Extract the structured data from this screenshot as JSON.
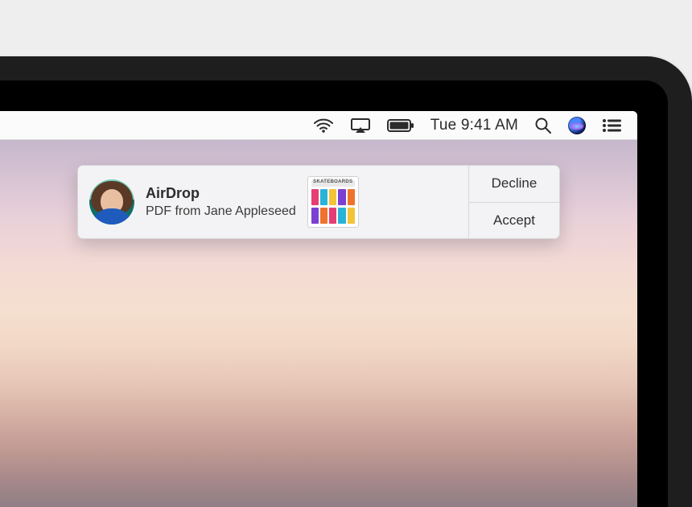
{
  "menubar": {
    "clock": "Tue 9:41 AM",
    "icons": {
      "wifi": "wifi-icon",
      "airplay": "airplay-icon",
      "battery": "battery-icon",
      "spotlight": "spotlight-search-icon",
      "siri": "siri-icon",
      "notification_center": "notification-center-icon"
    }
  },
  "notification": {
    "app_title": "AirDrop",
    "subtitle": "PDF from Jane Appleseed",
    "sender_name": "Jane Appleseed",
    "file_type": "PDF",
    "thumbnail_label": "SKATEBOARDS",
    "actions": {
      "decline": "Decline",
      "accept": "Accept"
    }
  }
}
